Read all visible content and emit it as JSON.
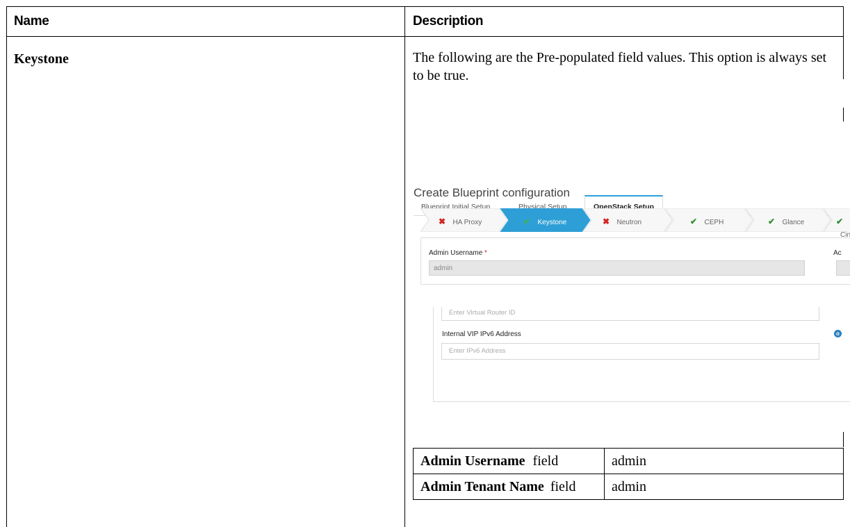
{
  "table": {
    "header_name": "Name",
    "header_description": "Description",
    "row_name": "Keystone",
    "row_description": "The following are the Pre-populated field values. This option is always set to be true."
  },
  "screenshot": {
    "title": "Create Blueprint configuration",
    "tabs": [
      {
        "label": "Blueprint Initial Setup",
        "active": false
      },
      {
        "label": "Physical Setup",
        "active": false
      },
      {
        "label": "OpenStack Setup",
        "active": true
      }
    ],
    "wizard_steps": [
      {
        "label": "HA Proxy",
        "status": "error",
        "icon": "x-icon",
        "active": false
      },
      {
        "label": "Keystone",
        "status": "ok",
        "icon": "check-icon",
        "active": true
      },
      {
        "label": "Neutron",
        "status": "error",
        "icon": "x-icon",
        "active": false
      },
      {
        "label": "CEPH",
        "status": "ok",
        "icon": "check-icon",
        "active": false
      },
      {
        "label": "Glance",
        "status": "ok",
        "icon": "check-icon",
        "active": false
      },
      {
        "label": "Cind",
        "status": "ok",
        "icon": "check-icon",
        "active": false
      }
    ],
    "admin_username_label": "Admin Username",
    "required_marker": "*",
    "admin_username_value": "admin",
    "right_cut_label": "Ac",
    "virtual_router_placeholder": "Enter Virtual Router ID",
    "internal_vip_ipv6_label": "Internal VIP IPv6 Address",
    "ipv6_placeholder": "Enter IPv6 Address",
    "info_glyph": "o",
    "colors": {
      "accent": "#2e9fd6",
      "error": "#d62020",
      "ok": "#2f8f2f"
    }
  },
  "nested_table": {
    "rows": [
      {
        "label": "Admin Username",
        "suffix": "field",
        "value": "admin"
      },
      {
        "label": "Admin Tenant Name",
        "suffix": "field",
        "value": "admin"
      }
    ]
  }
}
